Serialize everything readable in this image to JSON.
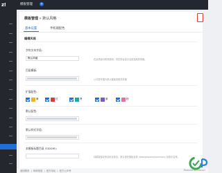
{
  "sidebar": {
    "logo": "z!"
  },
  "header": {
    "title": "模板管理",
    "add": "+"
  },
  "breadcrumb": {
    "root": "模板管理",
    "sep": "»",
    "current": "默认风格"
  },
  "tabs": [
    {
      "label": "基本设置"
    },
    {
      "label": "手机端配色"
    }
  ],
  "section": {
    "title": "编辑风格"
  },
  "form": {
    "template_name": {
      "label": "字符文本字段:",
      "value": "默认风格",
      "help": "在此界面可修改说明，将在前台显示当前选用的风格。"
    },
    "default_theme": {
      "label": "匹配模板:",
      "help": "以分类专题为默认模板的相关风格"
    },
    "colors": {
      "label": "扩展配色:",
      "items": [
        {
          "name": "黄",
          "color": "#f0b323"
        },
        {
          "name": "红",
          "color": "#d83b3b"
        },
        {
          "name": "青",
          "color": "#1aa9a9"
        },
        {
          "name": "紫",
          "color": "#7e57c2"
        },
        {
          "name": "粉",
          "color": "#ea6da1"
        }
      ]
    },
    "field4": {
      "label": "默认配色:"
    },
    "field5": {
      "label": "默认样式字段:"
    },
    "field6": {
      "label": "本模板标题目录 (SIDDIR):",
      "help": "将模板保存的目标目录名，默认值在模板目录 /data/phpwind/common/ 目录中名称。"
    }
  },
  "footer": {
    "links": [
      "返回首页",
      "系统信息",
      "官方论坛",
      "官方公众号"
    ],
    "powered": "Powered By Discuz!"
  }
}
